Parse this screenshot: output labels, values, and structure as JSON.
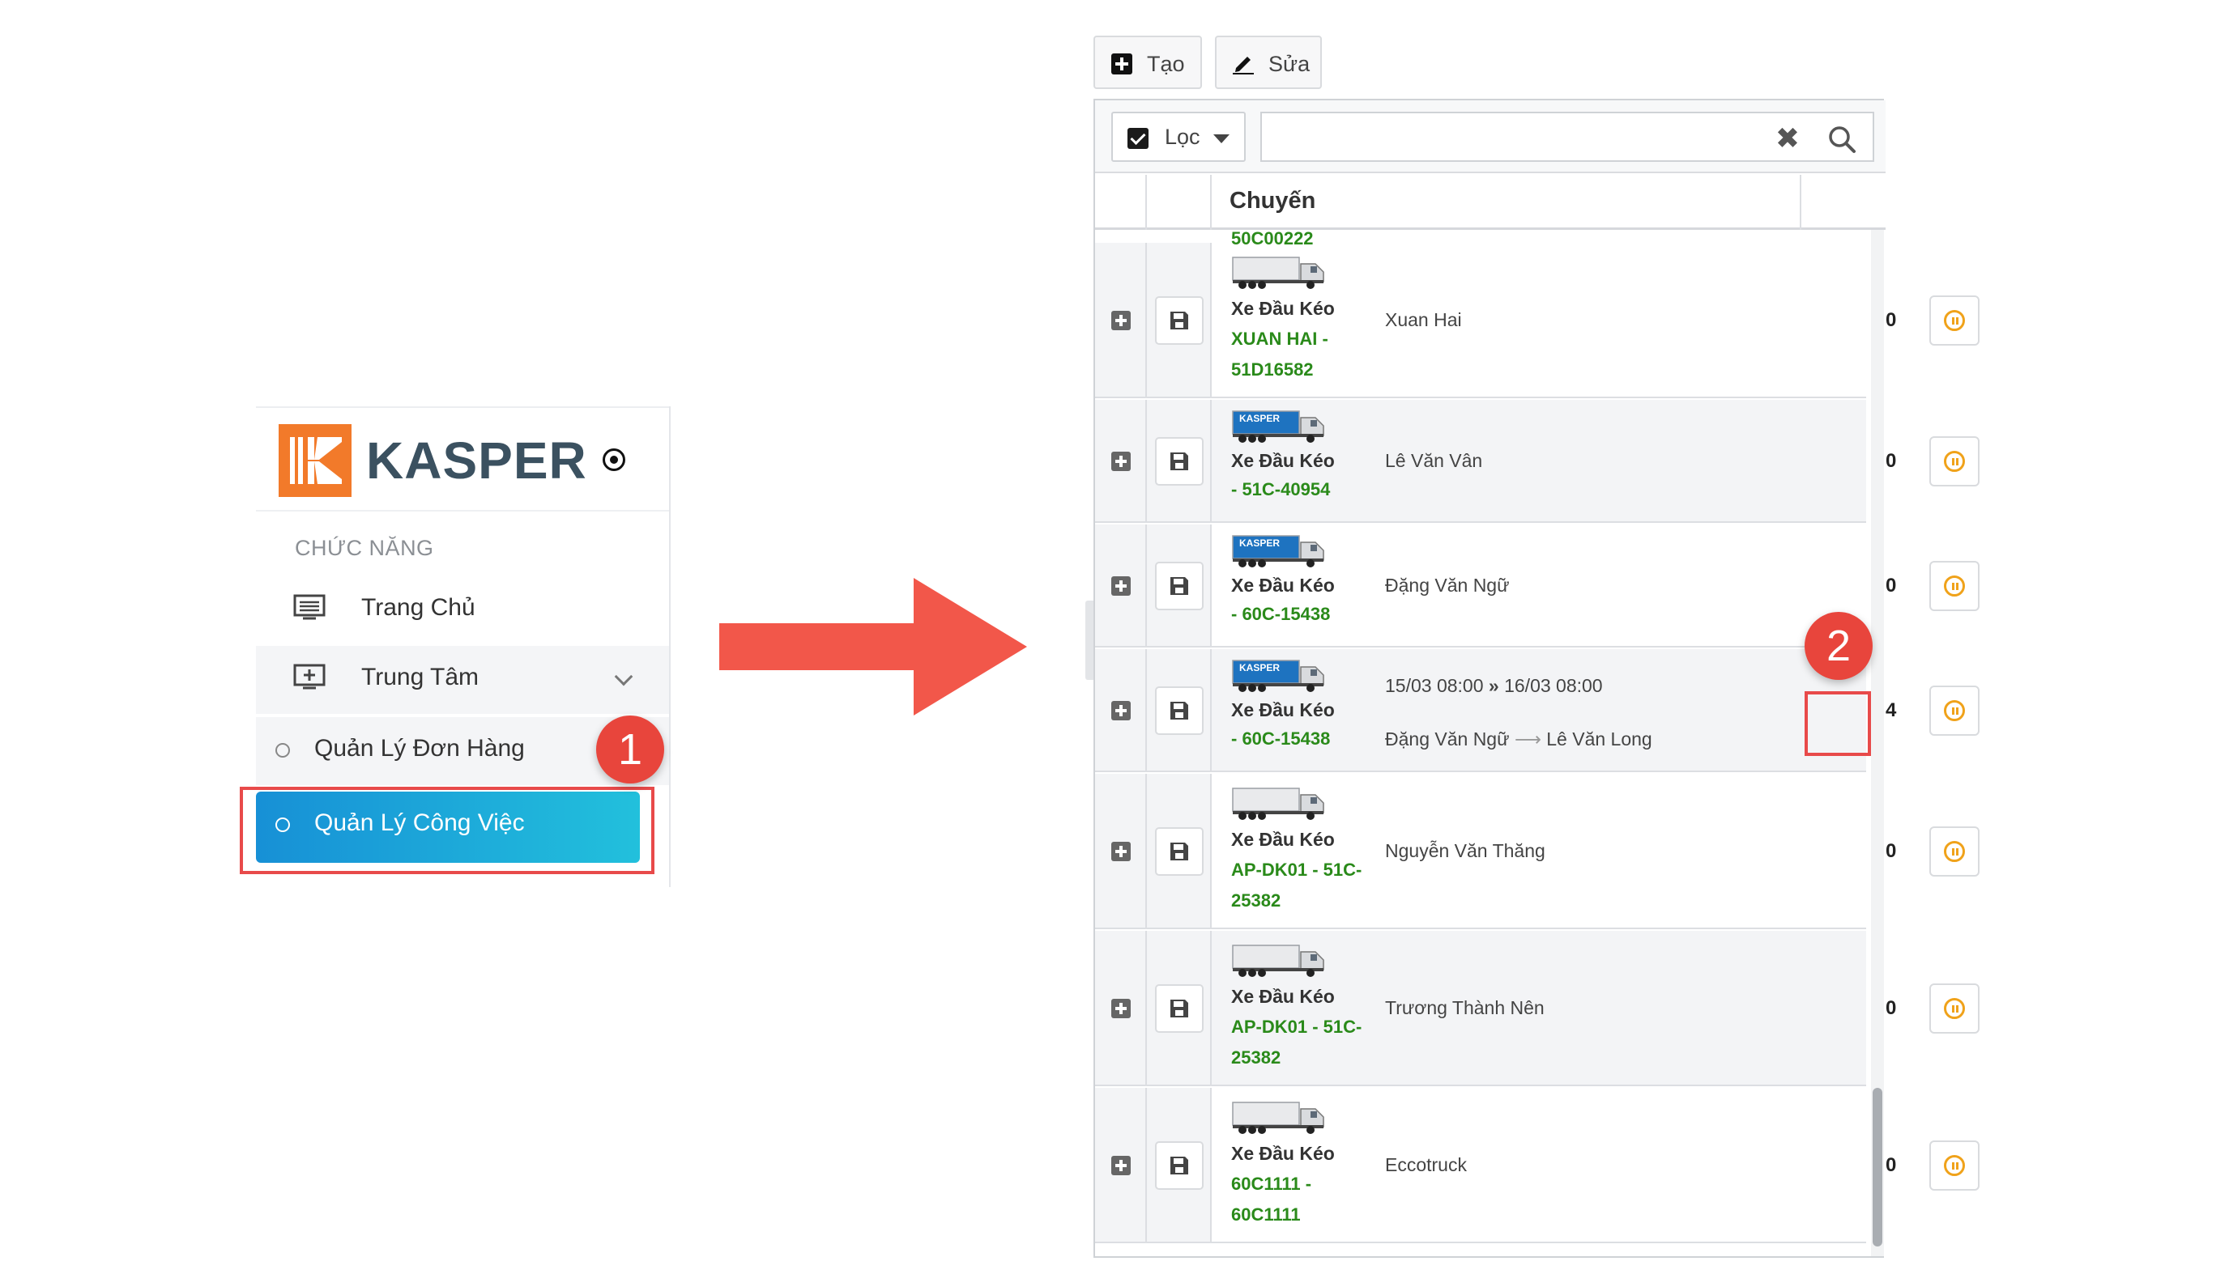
{
  "sidebar": {
    "brand": "KASPER",
    "section_title": "CHỨC NĂNG",
    "items": [
      {
        "label": "Trang Chủ",
        "icon": "monitor-list-icon"
      },
      {
        "label": "Trung Tâm",
        "icon": "monitor-plus-icon",
        "expanded": true
      }
    ],
    "sub_items": [
      {
        "label": "Quản Lý Đơn Hàng"
      },
      {
        "label": "Quản Lý Công Việc",
        "active": true
      }
    ]
  },
  "steps": {
    "step1": "1",
    "step2": "2"
  },
  "toolbar": {
    "create_label": "Tạo",
    "edit_label": "Sửa"
  },
  "filter": {
    "label": "Lọc",
    "checked": true,
    "search_value": "",
    "clear_symbol": "✖"
  },
  "table": {
    "header": "Chuyến",
    "clipped_text": "50C00222",
    "rows": [
      {
        "type": "Xe Đầu Kéo",
        "plate_line1": "XUAN HAI -",
        "plate_line2": "51D16582",
        "driver": "Xuan Hai",
        "count": "0",
        "truck": "plain"
      },
      {
        "type": "Xe Đầu Kéo",
        "plate_line1": "- 51C-40954",
        "plate_line2": "",
        "driver": "Lê Văn Vân",
        "count": "0",
        "truck": "kasper"
      },
      {
        "type": "Xe Đầu Kéo",
        "plate_line1": "- 60C-15438",
        "plate_line2": "",
        "driver": "Đặng Văn Ngữ",
        "count": "0",
        "truck": "kasper"
      },
      {
        "type": "Xe Đầu Kéo",
        "plate_line1": "- 60C-15438",
        "plate_line2": "",
        "time_from": "15/03 08:00",
        "time_sep": "»",
        "time_to": "16/03 08:00",
        "driver_from": "Đặng Văn Ngữ",
        "driver_to": "Lê Văn Long",
        "count": "4",
        "truck": "kasper"
      },
      {
        "type": "Xe Đầu Kéo",
        "plate_line1": "AP-DK01 - 51C-",
        "plate_line2": "25382",
        "driver": "Nguyễn Văn Thăng",
        "count": "0",
        "truck": "plain"
      },
      {
        "type": "Xe Đầu Kéo",
        "plate_line1": "AP-DK01 - 51C-",
        "plate_line2": "25382",
        "driver": "Trương Thành Nên",
        "count": "0",
        "truck": "plain"
      },
      {
        "type": "Xe Đầu Kéo",
        "plate_line1": "60C1111 -",
        "plate_line2": "60C1111",
        "driver": "Eccotruck",
        "count": "0",
        "truck": "plain"
      }
    ]
  },
  "colors": {
    "accent": "#e8453c",
    "brand_orange": "#f27a2a",
    "plate_green": "#2a8a1a",
    "pause_orange": "#f0a21a",
    "active_gradient_start": "#1790d6",
    "active_gradient_end": "#22c0dc"
  }
}
